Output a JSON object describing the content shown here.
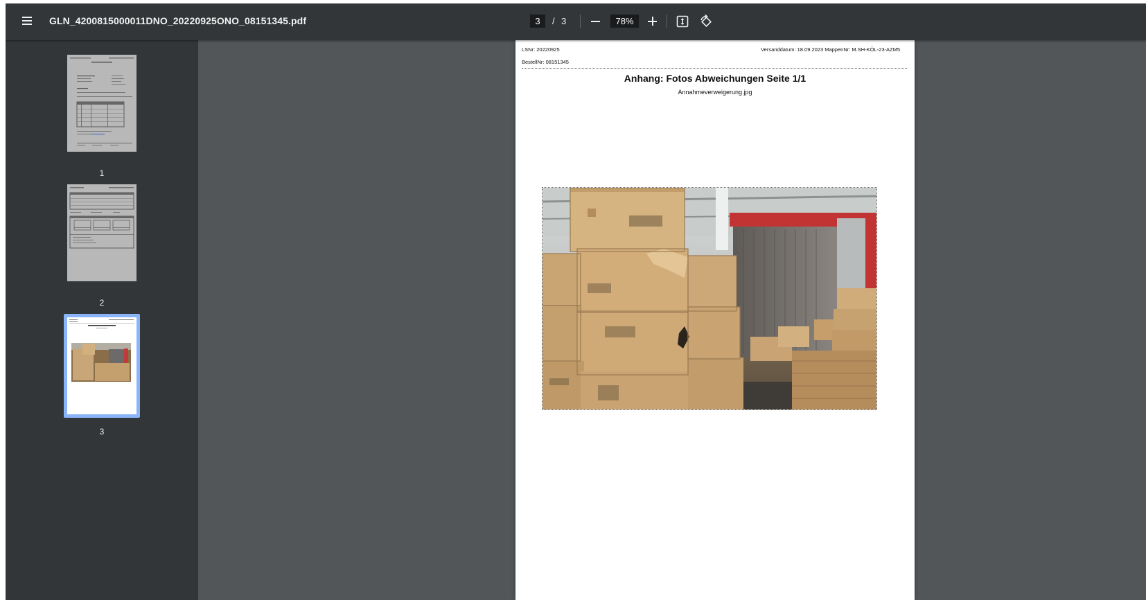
{
  "toolbar": {
    "file_name": "GLN_4200815000011DNO_20220925ONO_08151345.pdf",
    "current_page": "3",
    "page_separator": "/",
    "total_pages": "3",
    "zoom": "78%"
  },
  "thumbnails": [
    {
      "label": "1",
      "selected": false
    },
    {
      "label": "2",
      "selected": false
    },
    {
      "label": "3",
      "selected": true
    }
  ],
  "document": {
    "lsnr": "LSNr: 20220925",
    "bestellnr": "BestellNr: 08151345",
    "header_right": "Versanddatum: 18.09.2023 MappenNr: M.SH-KÖL-23-AZM5",
    "title": "Anhang: Fotos Abweichungen Seite  1/1",
    "image_filename": "Annahmeverweigerung.jpg"
  },
  "icons": {
    "menu": "menu-icon",
    "zoom_out": "minus-icon",
    "zoom_in": "plus-icon",
    "fit": "fit-to-page-icon",
    "rotate": "rotate-icon"
  }
}
